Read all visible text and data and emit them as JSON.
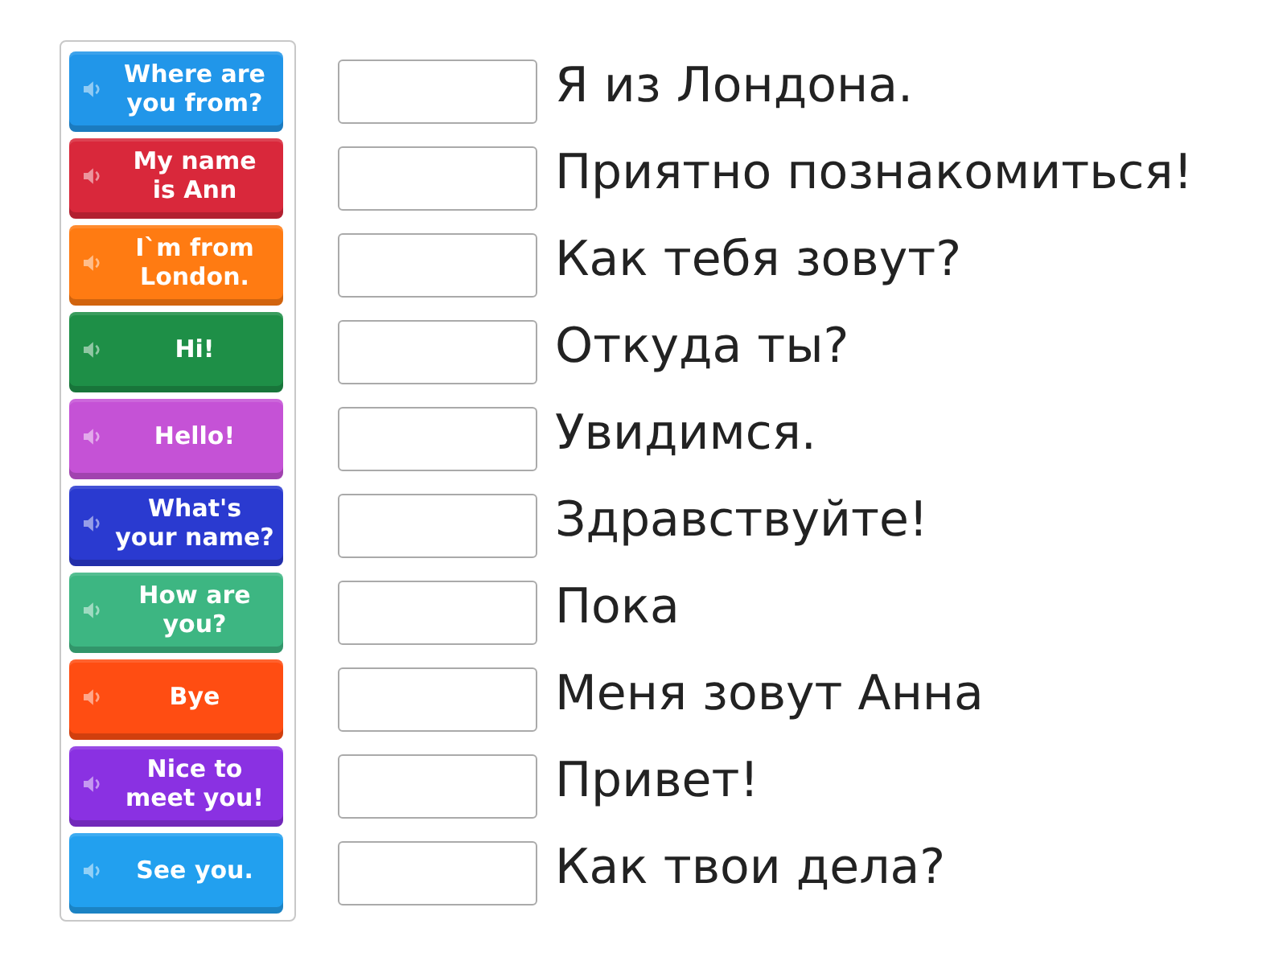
{
  "tiles": [
    {
      "text": "Where are you from?",
      "color": "#2196e9"
    },
    {
      "text": "My name is Ann",
      "color": "#d9283b"
    },
    {
      "text": "I`m from London.",
      "color": "#ff7b12"
    },
    {
      "text": "Hi!",
      "color": "#1e8f47"
    },
    {
      "text": "Hello!",
      "color": "#c552d6"
    },
    {
      "text": "What's your name?",
      "color": "#2a3ad0"
    },
    {
      "text": "How are you?",
      "color": "#3db682"
    },
    {
      "text": "Bye",
      "color": "#ff4d12"
    },
    {
      "text": "Nice to meet you!",
      "color": "#8a31e2"
    },
    {
      "text": "See you.",
      "color": "#22a0ef"
    }
  ],
  "targets": [
    {
      "text": "Я из Лондона."
    },
    {
      "text": "Приятно познакомиться!"
    },
    {
      "text": "Как тебя зовут?"
    },
    {
      "text": "Откуда ты?"
    },
    {
      "text": "Увидимся."
    },
    {
      "text": "Здравствуйте!"
    },
    {
      "text": "Пока"
    },
    {
      "text": "Меня зовут Анна"
    },
    {
      "text": "Привет!"
    },
    {
      "text": "Как твои дела?"
    }
  ]
}
